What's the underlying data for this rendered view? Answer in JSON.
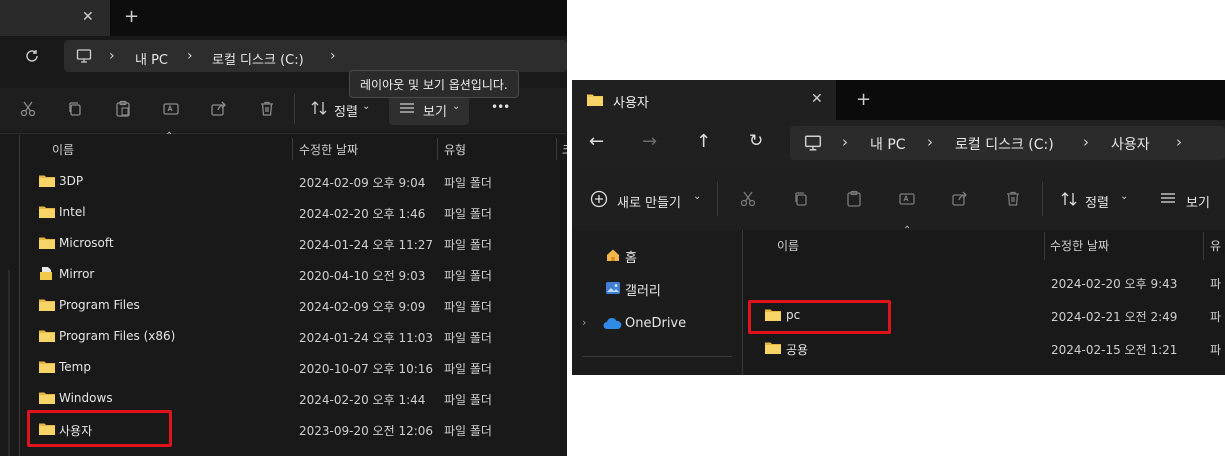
{
  "left_window": {
    "tabbar": {
      "close_glyph": "✕",
      "new_tab_glyph": "+"
    },
    "address": {
      "sep": "›",
      "crumbs": [
        "내 PC",
        "로컬 디스크 (C:)"
      ]
    },
    "tooltip": "레이아웃 및 보기 옵션입니다.",
    "toolbar": {
      "sort_label": "정렬",
      "view_label": "보기",
      "more_glyph": "•••"
    },
    "columns": {
      "name": "이름",
      "modified": "수정한 날짜",
      "type": "유형",
      "size": "크"
    },
    "rows": [
      {
        "name": "3DP",
        "modified": "2024-02-09 오후 9:04",
        "type": "파일 폴더",
        "icon": "folder"
      },
      {
        "name": "Intel",
        "modified": "2024-02-20 오후 1:46",
        "type": "파일 폴더",
        "icon": "folder"
      },
      {
        "name": "Microsoft",
        "modified": "2024-01-24 오후 11:27",
        "type": "파일 폴더",
        "icon": "folder"
      },
      {
        "name": "Mirror",
        "modified": "2020-04-10 오전 9:03",
        "type": "파일 폴더",
        "icon": "folder-file"
      },
      {
        "name": "Program Files",
        "modified": "2024-02-09 오후 9:09",
        "type": "파일 폴더",
        "icon": "folder"
      },
      {
        "name": "Program Files (x86)",
        "modified": "2024-01-24 오후 11:03",
        "type": "파일 폴더",
        "icon": "folder"
      },
      {
        "name": "Temp",
        "modified": "2020-10-07 오후 10:16",
        "type": "파일 폴더",
        "icon": "folder"
      },
      {
        "name": "Windows",
        "modified": "2024-02-20 오후 1:44",
        "type": "파일 폴더",
        "icon": "folder"
      },
      {
        "name": "사용자",
        "modified": "2023-09-20 오전 12:06",
        "type": "파일 폴더",
        "icon": "folder",
        "highlighted": true
      }
    ]
  },
  "right_window": {
    "tab": {
      "title": "사용자",
      "close_glyph": "✕",
      "new_tab_glyph": "+"
    },
    "nav": {
      "back": "←",
      "forward": "→",
      "up": "↑",
      "refresh": "↻"
    },
    "address": {
      "sep": "›",
      "crumbs": [
        "내 PC",
        "로컬 디스크 (C:)",
        "사용자"
      ]
    },
    "toolbar": {
      "new_label": "새로 만들기",
      "sort_label": "정렬",
      "view_label": "보기"
    },
    "sidebar": [
      {
        "label": "홈",
        "icon": "home"
      },
      {
        "label": "갤러리",
        "icon": "gallery"
      },
      {
        "label": "OneDrive",
        "icon": "cloud"
      }
    ],
    "columns": {
      "name": "이름",
      "modified": "수정한 날짜",
      "type": "유"
    },
    "rows": [
      {
        "name": "",
        "modified": "2024-02-20 오후 9:43",
        "type": "파"
      },
      {
        "name": "pc",
        "modified": "2024-02-21 오전 2:49",
        "type": "파",
        "highlighted": true
      },
      {
        "name": "공용",
        "modified": "2024-02-15 오전 1:21",
        "type": "파"
      }
    ]
  },
  "colors": {
    "highlight": "#e0121c",
    "folder": "#f2c94c",
    "background": "#191919"
  }
}
